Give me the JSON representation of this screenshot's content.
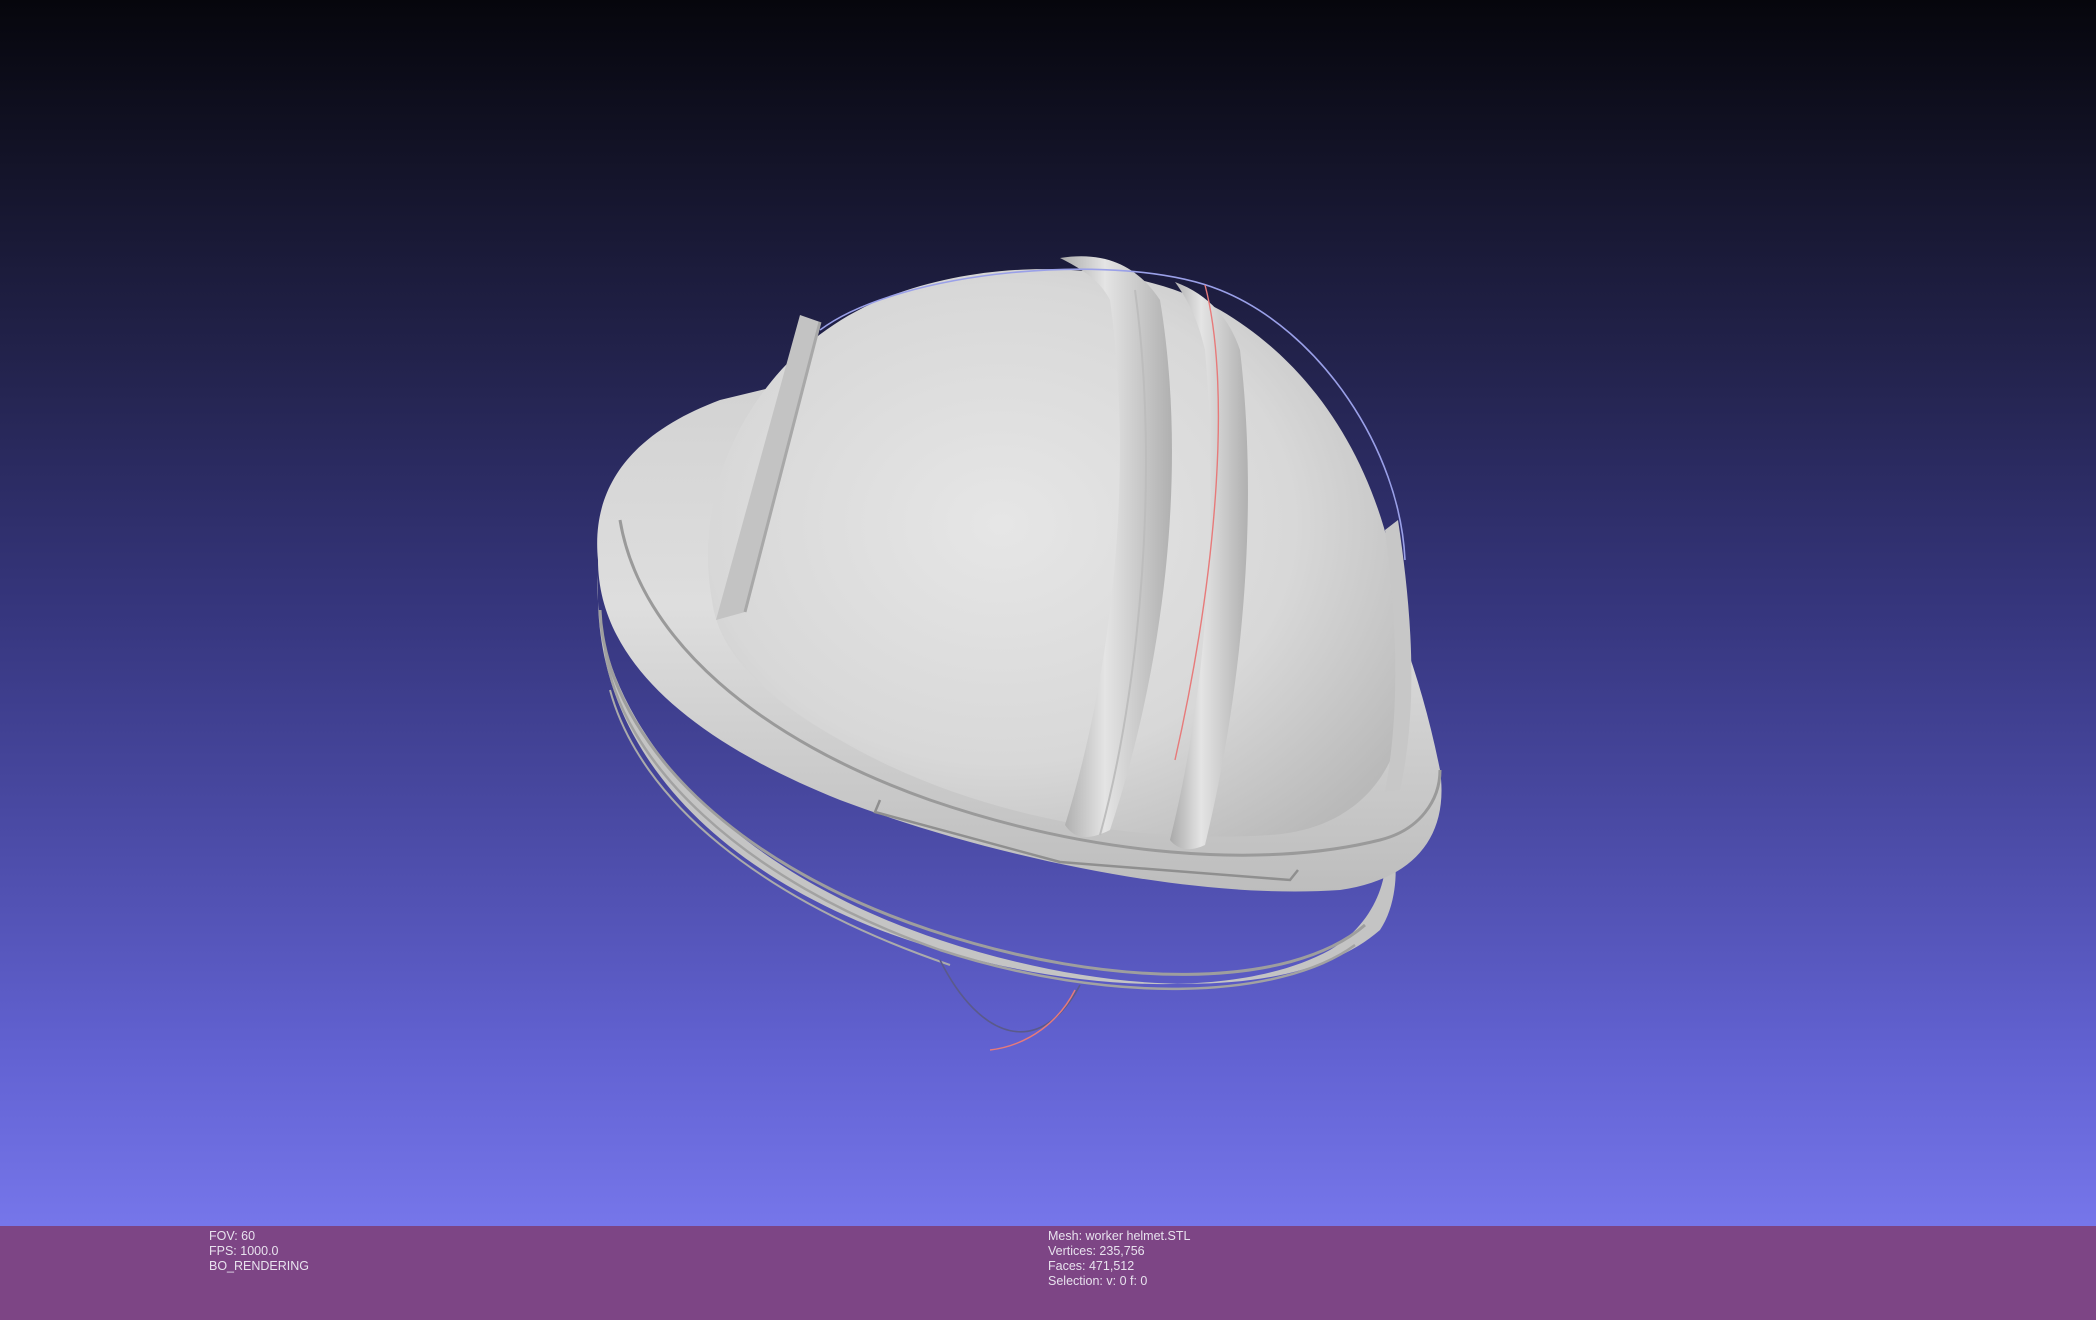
{
  "viewer": {
    "background_top": "#06060c",
    "background_bottom": "#7676ea",
    "info_bar_color": "#7d4585",
    "model_color": "#d9d9d9"
  },
  "info_left": {
    "fov": "FOV: 60",
    "fps": "FPS:  1000.0",
    "mode": "BO_RENDERING"
  },
  "info_right": {
    "mesh": "Mesh: worker helmet.STL",
    "vertices": "Vertices: 235,756",
    "faces": "Faces: 471,512",
    "selection": "Selection: v: 0 f: 0"
  }
}
